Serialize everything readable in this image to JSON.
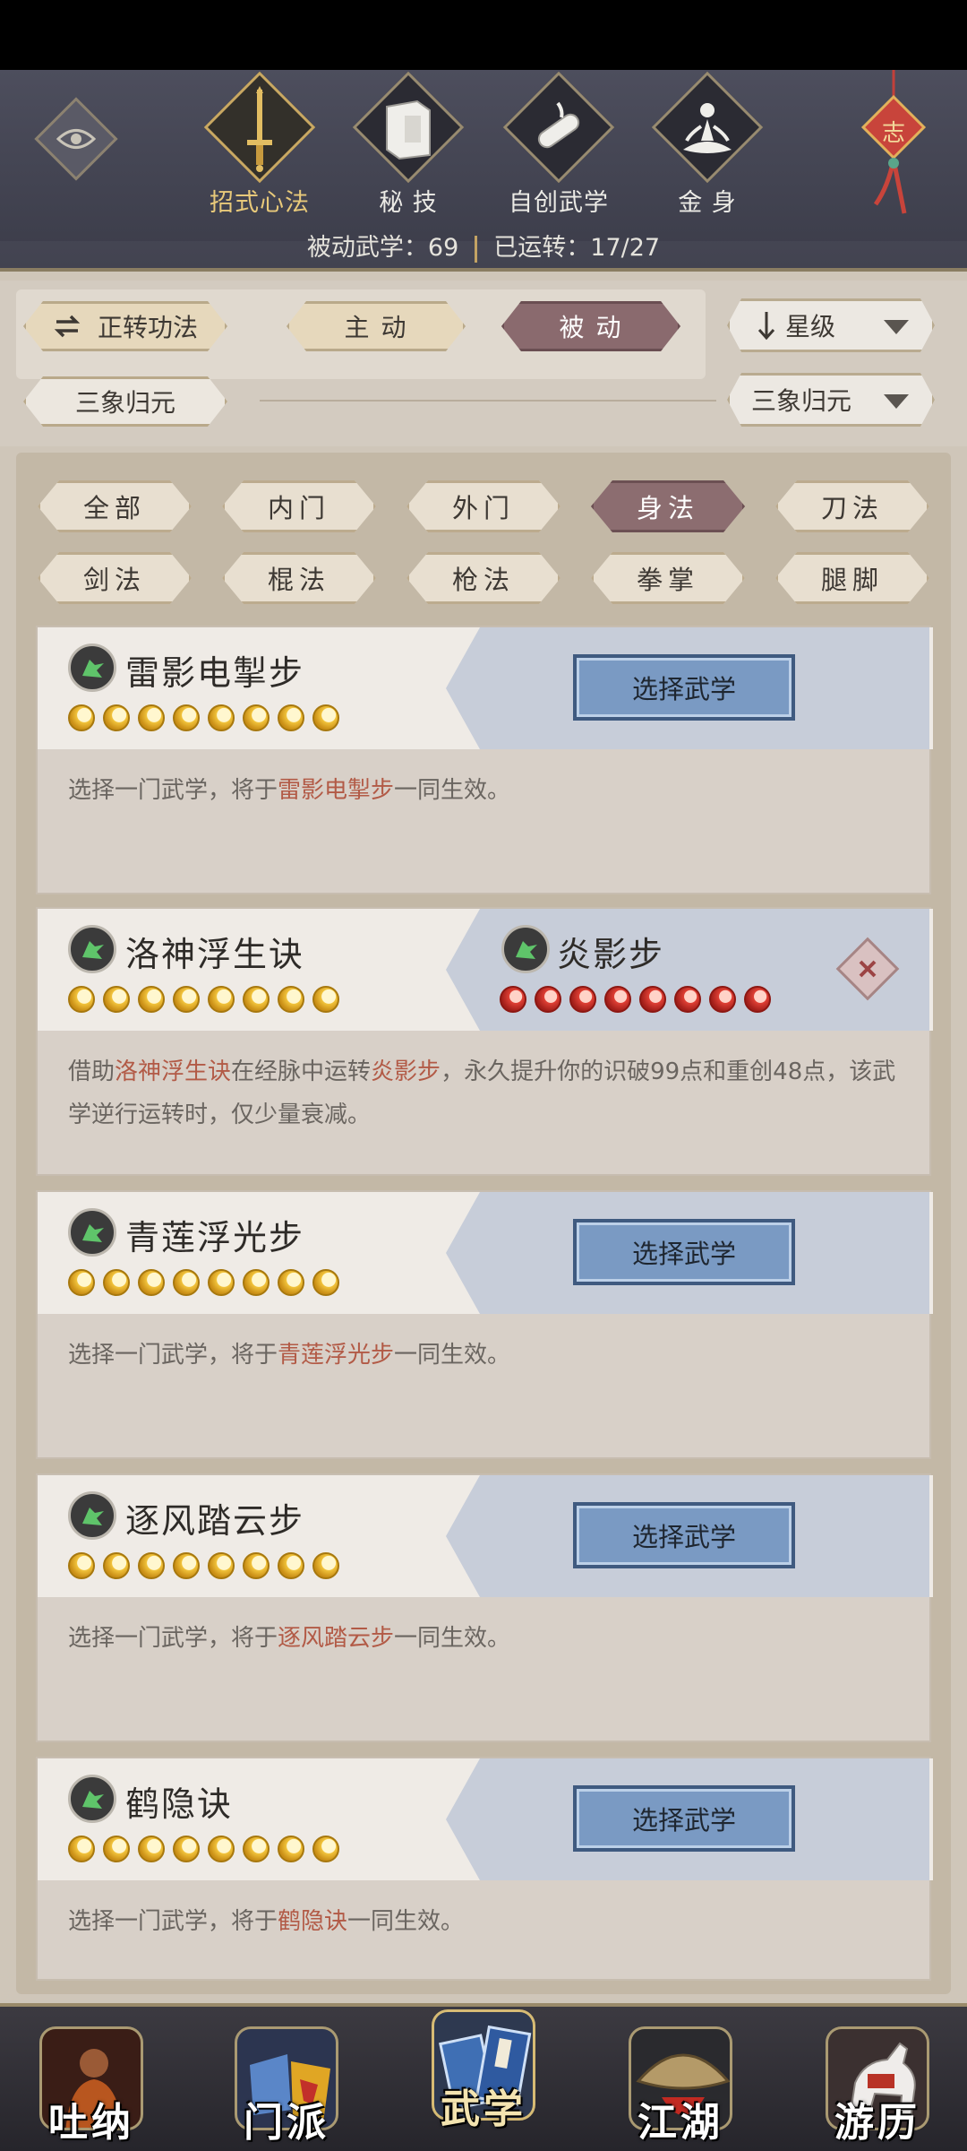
{
  "top": {
    "tabs": [
      {
        "label": "招式心法",
        "icon": "sword-icon",
        "active": true
      },
      {
        "label": "秘  技",
        "icon": "book-icon",
        "active": false
      },
      {
        "label": "自创武学",
        "icon": "scroll-icon",
        "active": false
      },
      {
        "label": "金  身",
        "icon": "meditation-icon",
        "active": false
      }
    ],
    "knot_char": "志",
    "summary_passive_label": "被动武学：",
    "summary_passive_value": "69",
    "summary_active_label": "已运转：",
    "summary_active_value": "17/27"
  },
  "filters": {
    "reverse_label": "正转功法",
    "active_label": "主  动",
    "passive_label": "被  动",
    "sort_label": "星级",
    "sanxiang_label": "三象归元",
    "sanxiang_dropdown": "三象归元"
  },
  "categories": [
    "全部",
    "内门",
    "外门",
    "身法",
    "刀法",
    "剑法",
    "棍法",
    "枪法",
    "拳掌",
    "腿脚"
  ],
  "cards": [
    {
      "name": "雷影电掣步",
      "button": "选择武学",
      "desc_pre": "选择一门武学，将于",
      "desc_hl": "雷影电掣步",
      "desc_post": "一同生效。"
    },
    {
      "name": "洛神浮生诀",
      "linked_name": "炎影步",
      "desc_pre": "借助",
      "desc_hl": "洛神浮生诀",
      "desc_mid": "在经脉中运转",
      "desc_hl2": "炎影步",
      "desc_post": "，永久提升你的识破99点和重创48点，该武学逆行运转时，仅少量衰减。"
    },
    {
      "name": "青莲浮光步",
      "button": "选择武学",
      "desc_pre": "选择一门武学，将于",
      "desc_hl": "青莲浮光步",
      "desc_post": "一同生效。"
    },
    {
      "name": "逐风踏云步",
      "button": "选择武学",
      "desc_pre": "选择一门武学，将于",
      "desc_hl": "逐风踏云步",
      "desc_post": "一同生效。"
    },
    {
      "name": "鹤隐诀",
      "button": "选择武学",
      "desc_pre": "选择一门武学，将于",
      "desc_hl": "鹤隐诀",
      "desc_post": "一同生效。"
    }
  ],
  "nav": [
    {
      "label": "吐纳"
    },
    {
      "label": "门派"
    },
    {
      "label": "武学",
      "active": true
    },
    {
      "label": "江湖"
    },
    {
      "label": "游历"
    }
  ],
  "colors": {
    "accent_gold": "#e8c97a",
    "active_pill": "#8a6a6e",
    "select_button": "#7a9ac3",
    "highlight_text": "#b25a46"
  }
}
